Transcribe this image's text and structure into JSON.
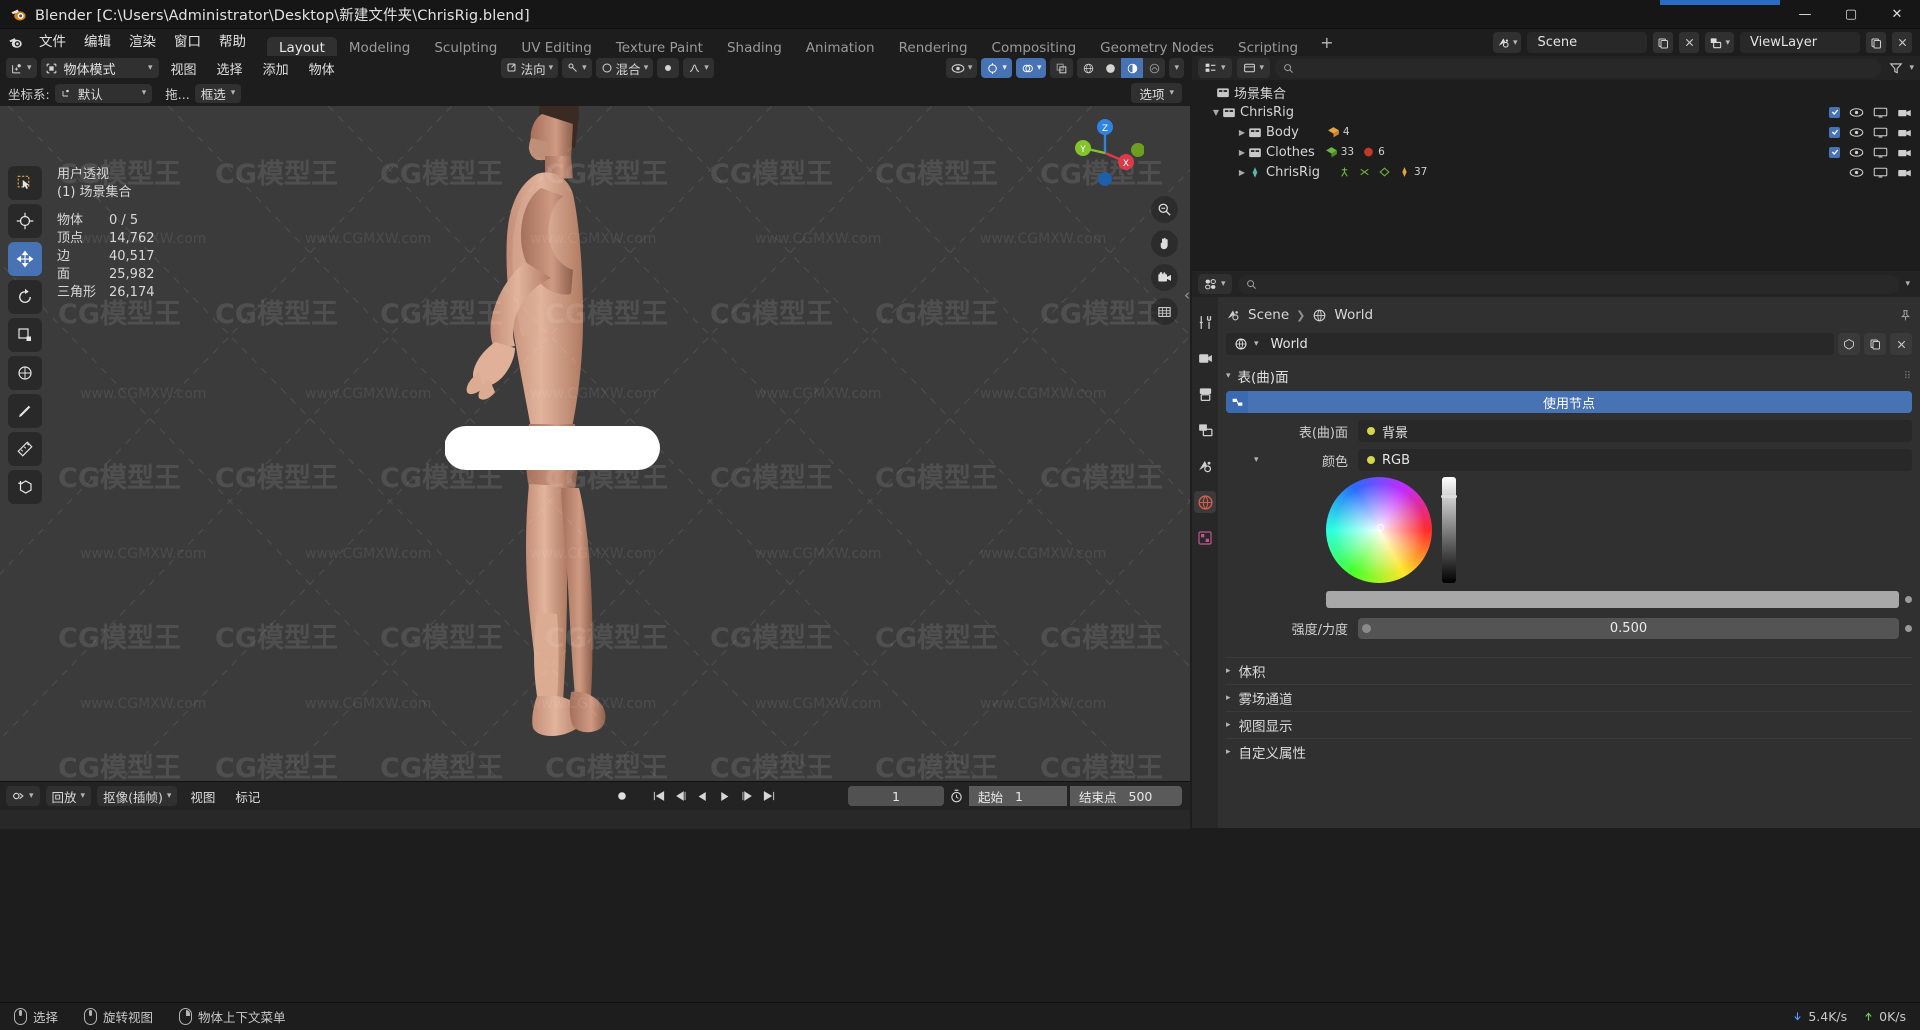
{
  "window": {
    "title": "Blender [C:\\Users\\Administrator\\Desktop\\新建文件夹\\ChrisRig.blend]",
    "minimize": "—",
    "maximize": "▢",
    "close": "✕"
  },
  "topbar": {
    "menus": [
      "文件",
      "编辑",
      "渲染",
      "窗口",
      "帮助"
    ],
    "workspaces": [
      "Layout",
      "Modeling",
      "Sculpting",
      "UV Editing",
      "Texture Paint",
      "Shading",
      "Animation",
      "Rendering",
      "Compositing",
      "Geometry Nodes",
      "Scripting"
    ],
    "active_workspace": "Layout",
    "add_workspace": "+",
    "scene_name": "Scene",
    "viewlayer_name": "ViewLayer"
  },
  "viewport": {
    "header": {
      "mode": "物体模式",
      "menus": [
        "视图",
        "选择",
        "添加",
        "物体"
      ],
      "transform_orientation": "法向",
      "snap_mode": "混合",
      "options_label": "选项"
    },
    "header2": {
      "orientation_label": "坐标系:",
      "orientation_value": "默认",
      "drag_label": "拖...",
      "drag_value": "框选"
    },
    "overlay": {
      "view_name": "用户透视",
      "collection": "(1) 场景集合",
      "stats": [
        {
          "key": "物体",
          "value": "0 / 5"
        },
        {
          "key": "顶点",
          "value": "14,762"
        },
        {
          "key": "边",
          "value": "40,517"
        },
        {
          "key": "面",
          "value": "25,982"
        },
        {
          "key": "三角形",
          "value": "26,174"
        }
      ]
    },
    "gizmo_axes": [
      "Z",
      "X",
      "Y"
    ],
    "tools": [
      "tweak-tool",
      "cursor-tool",
      "move-tool",
      "rotate-tool",
      "scale-tool",
      "transform-tool",
      "annotate-tool",
      "measure-tool",
      "add-cube-tool"
    ],
    "active_tool": "move-tool"
  },
  "timeline": {
    "playback_label": "回放",
    "keying_label": "抠像(插帧)",
    "view_label": "视图",
    "marker_label": "标记",
    "current_frame": "1",
    "start_label": "起始",
    "start_value": "1",
    "end_label": "结束点",
    "end_value": "500"
  },
  "outliner": {
    "search_placeholder": "",
    "filter_icon": "filter-icon",
    "rows": [
      {
        "indent": 0,
        "name": "场景集合",
        "icon": "collection-icon",
        "expander": "",
        "checkbox": null,
        "eye": false,
        "screen": false,
        "camera": false,
        "counts": []
      },
      {
        "indent": 1,
        "name": "ChrisRig",
        "icon": "collection-icon",
        "expander": "▼",
        "checkbox": true,
        "eye": true,
        "screen": true,
        "camera": true,
        "counts": []
      },
      {
        "indent": 2,
        "name": "Body",
        "icon": "mesh-icon",
        "expander": "▶",
        "checkbox": true,
        "eye": true,
        "screen": true,
        "camera": true,
        "counts": [
          "4"
        ]
      },
      {
        "indent": 2,
        "name": "Clothes",
        "icon": "mesh-icon",
        "expander": "▶",
        "checkbox": true,
        "eye": true,
        "screen": true,
        "camera": true,
        "counts": [
          "33",
          "6"
        ]
      },
      {
        "indent": 2,
        "name": "ChrisRig",
        "icon": "armature-icon",
        "expander": "▶",
        "checkbox": false,
        "eye": true,
        "screen": true,
        "camera": true,
        "counts": [
          "37"
        ]
      }
    ]
  },
  "properties": {
    "search_placeholder": "",
    "breadcrumb": [
      "Scene",
      "World"
    ],
    "world_name": "World",
    "panels": {
      "surface": {
        "title": "表(曲)面",
        "use_nodes_label": "使用节点",
        "rows": [
          {
            "label": "表(曲)面",
            "value": "背景",
            "dot": "#d6d64a"
          },
          {
            "label": "颜色",
            "value": "RGB",
            "dot": "#d6d64a"
          }
        ],
        "strength_label": "强度/力度",
        "strength_value": "0.500"
      },
      "closed": [
        "体积",
        "雾场通道",
        "视图显示",
        "自定义属性"
      ]
    }
  },
  "statusbar": {
    "select": "选择",
    "rotate_view": "旋转视图",
    "object_context_menu": "物体上下文菜单",
    "download_rate": "5.4K/s",
    "upload_rate": "0K/s"
  },
  "colors": {
    "accent_blue": "#4772b3",
    "bg_dark": "#1d1d1d",
    "bg_panel": "#303030",
    "viewport_bg": "#3b3b3b"
  },
  "watermark": {
    "text": "www.CGMXW.com",
    "logo": "CG模型王"
  }
}
